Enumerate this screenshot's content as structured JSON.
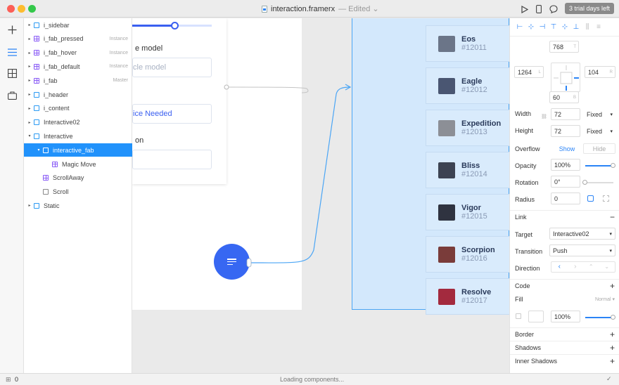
{
  "window": {
    "title": "interaction.framerx",
    "status": "Edited",
    "trial_label": "3 trial days left"
  },
  "toolbar_icons": [
    "play-icon",
    "device-icon",
    "comment-icon"
  ],
  "rail": [
    "plus-icon",
    "layers-icon",
    "grid-icon",
    "store-icon"
  ],
  "layers": [
    {
      "label": "i_sidebar",
      "icon": "frame",
      "caret": "▸",
      "indent": 0,
      "tag": ""
    },
    {
      "label": "i_fab_pressed",
      "icon": "component",
      "caret": "▸",
      "indent": 0,
      "tag": "Instance"
    },
    {
      "label": "i_fab_hover",
      "icon": "component",
      "caret": "▸",
      "indent": 0,
      "tag": "Instance"
    },
    {
      "label": "i_fab_default",
      "icon": "component",
      "caret": "▸",
      "indent": 0,
      "tag": "Instance"
    },
    {
      "label": "i_fab",
      "icon": "component",
      "caret": "▸",
      "indent": 0,
      "tag": "Master"
    },
    {
      "label": "i_header",
      "icon": "frame",
      "caret": "▸",
      "indent": 0,
      "tag": ""
    },
    {
      "label": "i_content",
      "icon": "frame",
      "caret": "▸",
      "indent": 0,
      "tag": ""
    },
    {
      "label": "Interactive02",
      "icon": "frame",
      "caret": "▸",
      "indent": 0,
      "tag": ""
    },
    {
      "label": "Interactive",
      "icon": "frame",
      "caret": "▾",
      "indent": 0,
      "tag": ""
    },
    {
      "label": "interactive_fab",
      "icon": "frame",
      "caret": "▾",
      "indent": 1,
      "tag": "",
      "selected": true
    },
    {
      "label": "Magic Move",
      "icon": "component",
      "caret": "",
      "indent": 2,
      "tag": ""
    },
    {
      "label": "ScrollAway",
      "icon": "component",
      "caret": "",
      "indent": 1,
      "tag": ""
    },
    {
      "label": "Scroll",
      "icon": "scroll",
      "caret": "",
      "indent": 1,
      "tag": ""
    },
    {
      "label": "Static",
      "icon": "frame",
      "caret": "▸",
      "indent": 0,
      "tag": ""
    }
  ],
  "canvas": {
    "form": {
      "label_model": "e model",
      "input_model_placeholder": "cle model",
      "input_service_value": "ice Needed",
      "label_location": "on"
    },
    "cars": [
      {
        "name": "Eos",
        "id": "#12011",
        "thumb": "#6b7588"
      },
      {
        "name": "Eagle",
        "id": "#12012",
        "thumb": "#4a5672"
      },
      {
        "name": "Expedition",
        "id": "#12013",
        "thumb": "#8c8f96"
      },
      {
        "name": "Bliss",
        "id": "#12014",
        "thumb": "#3d4352"
      },
      {
        "name": "Vigor",
        "id": "#12015",
        "thumb": "#2f3340"
      },
      {
        "name": "Scorpion",
        "id": "#12016",
        "thumb": "#7a3c3a"
      },
      {
        "name": "Resolve",
        "id": "#12017",
        "thumb": "#a32a3e"
      }
    ]
  },
  "props": {
    "top": "768",
    "top_suffix": "T",
    "left": "1264",
    "left_suffix": "L",
    "right": "104",
    "right_suffix": "R",
    "bottom": "60",
    "bottom_suffix": "B",
    "width_label": "Width",
    "width_value": "72",
    "width_mode": "Fixed",
    "height_label": "Height",
    "height_value": "72",
    "height_mode": "Fixed",
    "overflow_label": "Overflow",
    "overflow_show": "Show",
    "overflow_hide": "Hide",
    "opacity_label": "Opacity",
    "opacity_value": "100%",
    "opacity_level": 1.0,
    "rotation_label": "Rotation",
    "rotation_value": "0°",
    "rotation_level": 0.0,
    "radius_label": "Radius",
    "radius_value": "0",
    "link_label": "Link",
    "target_label": "Target",
    "target_value": "Interactive02",
    "transition_label": "Transition",
    "transition_value": "Push",
    "direction_label": "Direction",
    "code_label": "Code",
    "fill_label": "Fill",
    "fill_mode": "Normal",
    "fill_opacity": "100%",
    "fill_level": 1.0,
    "border_label": "Border",
    "shadows_label": "Shadows",
    "inner_shadows_label": "Inner Shadows"
  },
  "statusbar": {
    "count": "0",
    "message": "Loading components..."
  },
  "colors": {
    "accent": "#2192fb",
    "fab": "#3767f2",
    "frame_selected": "#d3e8fc"
  }
}
